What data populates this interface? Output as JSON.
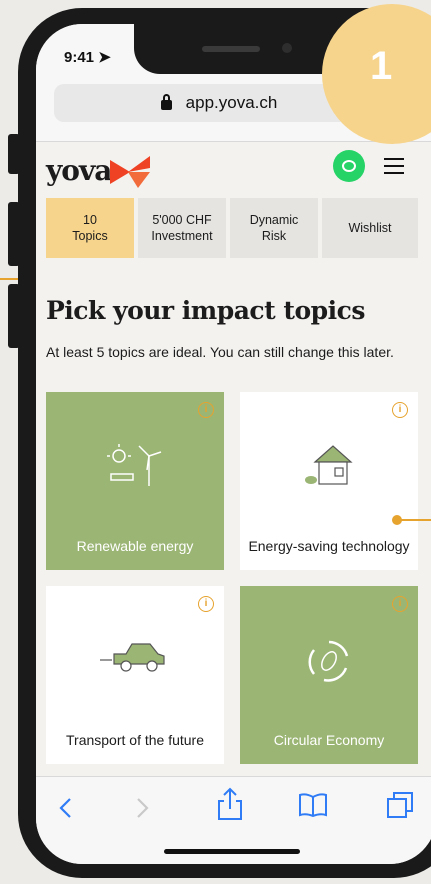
{
  "status_bar": {
    "time": "9:41"
  },
  "browser": {
    "url": "app.yova.ch"
  },
  "header": {
    "logo": "yova"
  },
  "tabs": [
    {
      "label": "10\nTopics",
      "active": true
    },
    {
      "label": "5'000 CHF\nInvestment",
      "active": false
    },
    {
      "label": "Dynamic\nRisk",
      "active": false
    },
    {
      "label": "Wishlist",
      "active": false
    }
  ],
  "main": {
    "title": "Pick your impact topics",
    "subtitle": "At least 5 topics are ideal. You can still change this later."
  },
  "topics": [
    {
      "label": "Renewable energy",
      "selected": true
    },
    {
      "label": "Energy-saving technology",
      "selected": false
    },
    {
      "label": "Transport of the future",
      "selected": false
    },
    {
      "label": "Circular Economy",
      "selected": true
    }
  ],
  "badge": {
    "step": "1"
  },
  "colors": {
    "accent": "#f7d48c",
    "selected_card": "#9bb574",
    "info": "#e6a32e",
    "browser_blue": "#2f7cf6"
  }
}
